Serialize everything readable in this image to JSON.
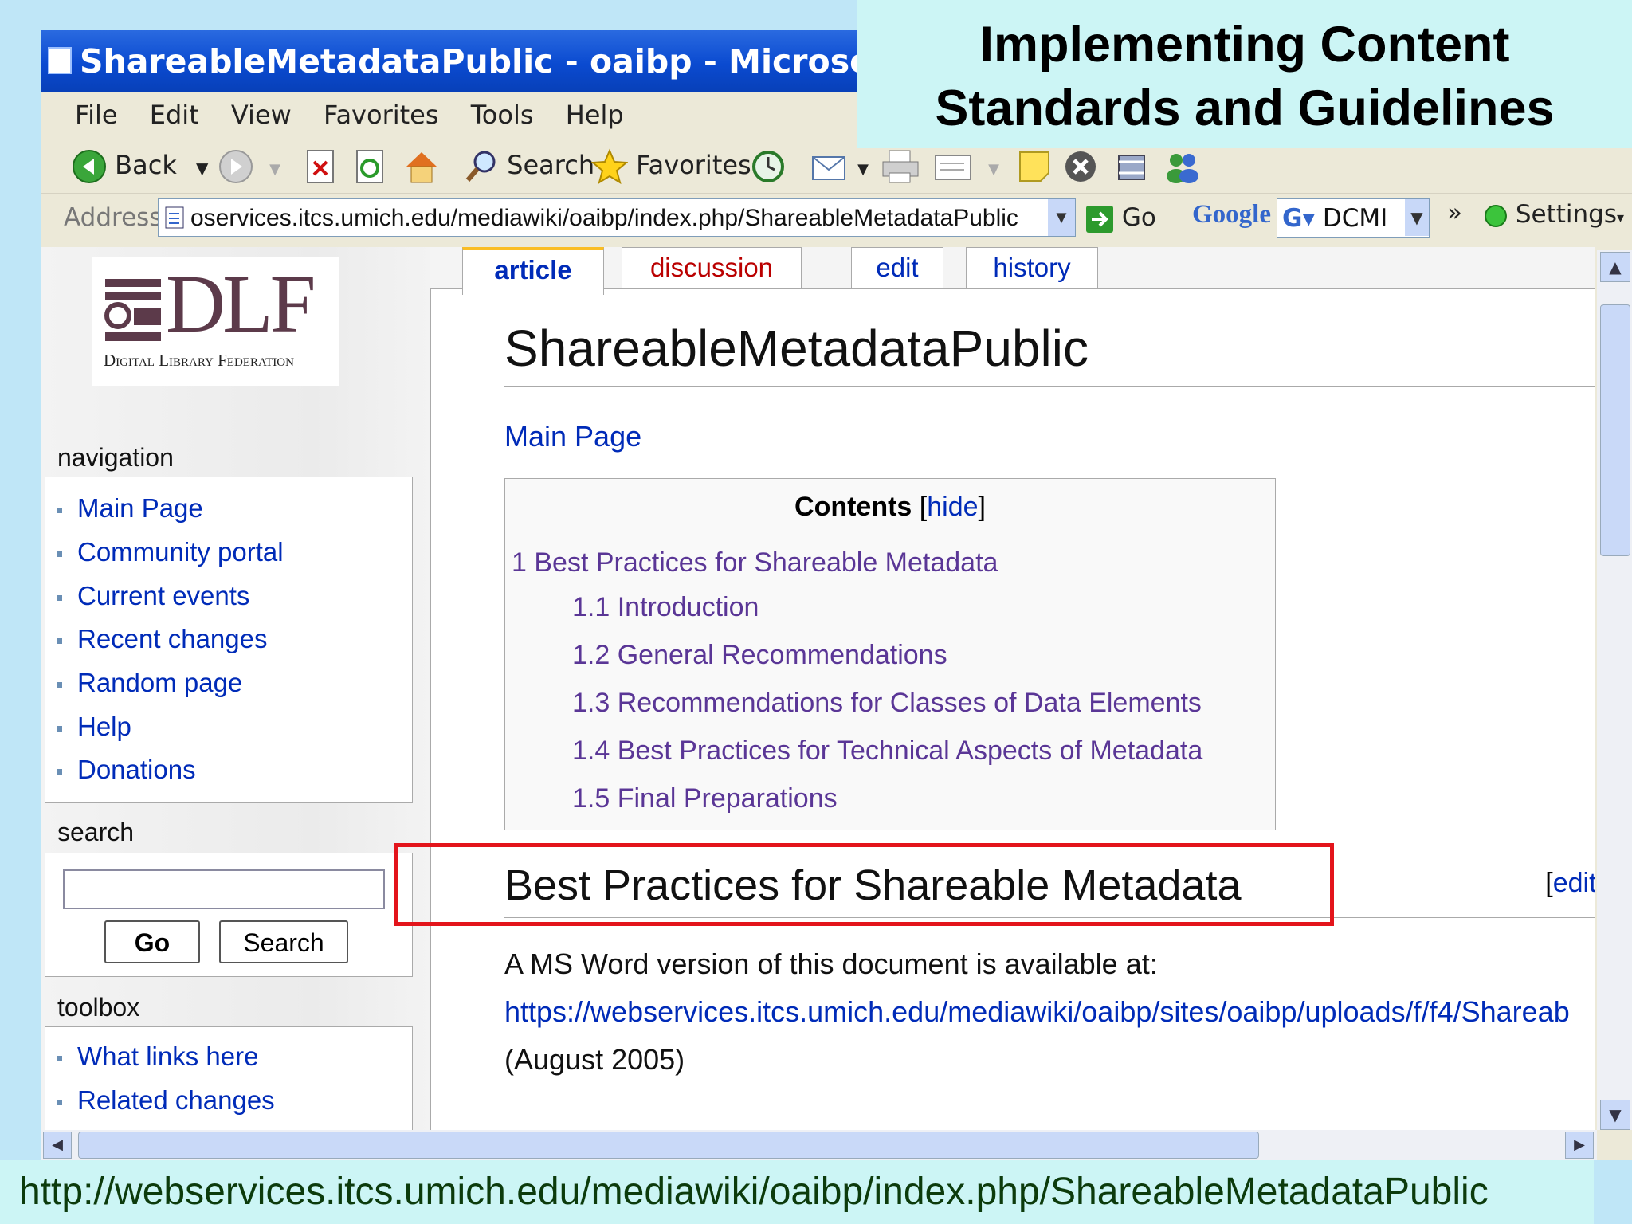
{
  "window": {
    "title": "ShareableMetadataPublic - oaibp - Microsoft Int"
  },
  "menu": [
    "File",
    "Edit",
    "View",
    "Favorites",
    "Tools",
    "Help"
  ],
  "toolbar": {
    "back": "Back",
    "search": "Search",
    "favorites": "Favorites"
  },
  "address": {
    "label": "Address",
    "url": "oservices.itcs.umich.edu/mediawiki/oaibp/index.php/ShareableMetadataPublic",
    "go": "Go",
    "google": "Google",
    "google_query": "DCMI",
    "more": "»",
    "settings": "Settings"
  },
  "sidebar": {
    "logo_main": "DLF",
    "logo_sub": "Digital Library Federation",
    "navigation_title": "navigation",
    "navigation": [
      "Main Page",
      "Community portal",
      "Current events",
      "Recent changes",
      "Random page",
      "Help",
      "Donations"
    ],
    "search_title": "search",
    "search_go": "Go",
    "search_button": "Search",
    "toolbox_title": "toolbox",
    "toolbox": [
      "What links here",
      "Related changes"
    ]
  },
  "tabs": [
    "article",
    "discussion",
    "edit",
    "history"
  ],
  "article": {
    "title": "ShareableMetadataPublic",
    "main_page_link": "Main Page",
    "contents_title": "Contents",
    "contents_hide": "hide",
    "toc": [
      "1 Best Practices for Shareable Metadata",
      "1.1 Introduction",
      "1.2 General Recommendations",
      "1.3 Recommendations for Classes of Data Elements",
      "1.4 Best Practices for Technical Aspects of Metadata",
      "1.5 Final Preparations"
    ],
    "section_heading": "Best Practices for Shareable Metadata",
    "section_edit": "edit",
    "body_text": "A MS Word version of this document is available at:",
    "body_link": "https://webservices.itcs.umich.edu/mediawiki/oaibp/sites/oaibp/uploads/f/f4/Shareab",
    "body_date": "(August 2005)"
  },
  "slide": {
    "title_line1": "Implementing Content",
    "title_line2": "Standards and Guidelines",
    "footer_url": "http://webservices.itcs.umich.edu/mediawiki/oaibp/index.php/ShareableMetadataPublic"
  },
  "colors": {
    "titlebar": "#0a4ad0",
    "link": "#002bb8",
    "visited_link": "#5a3696",
    "highlight": "#e3141b",
    "slide_band": "#ccf5f5"
  }
}
